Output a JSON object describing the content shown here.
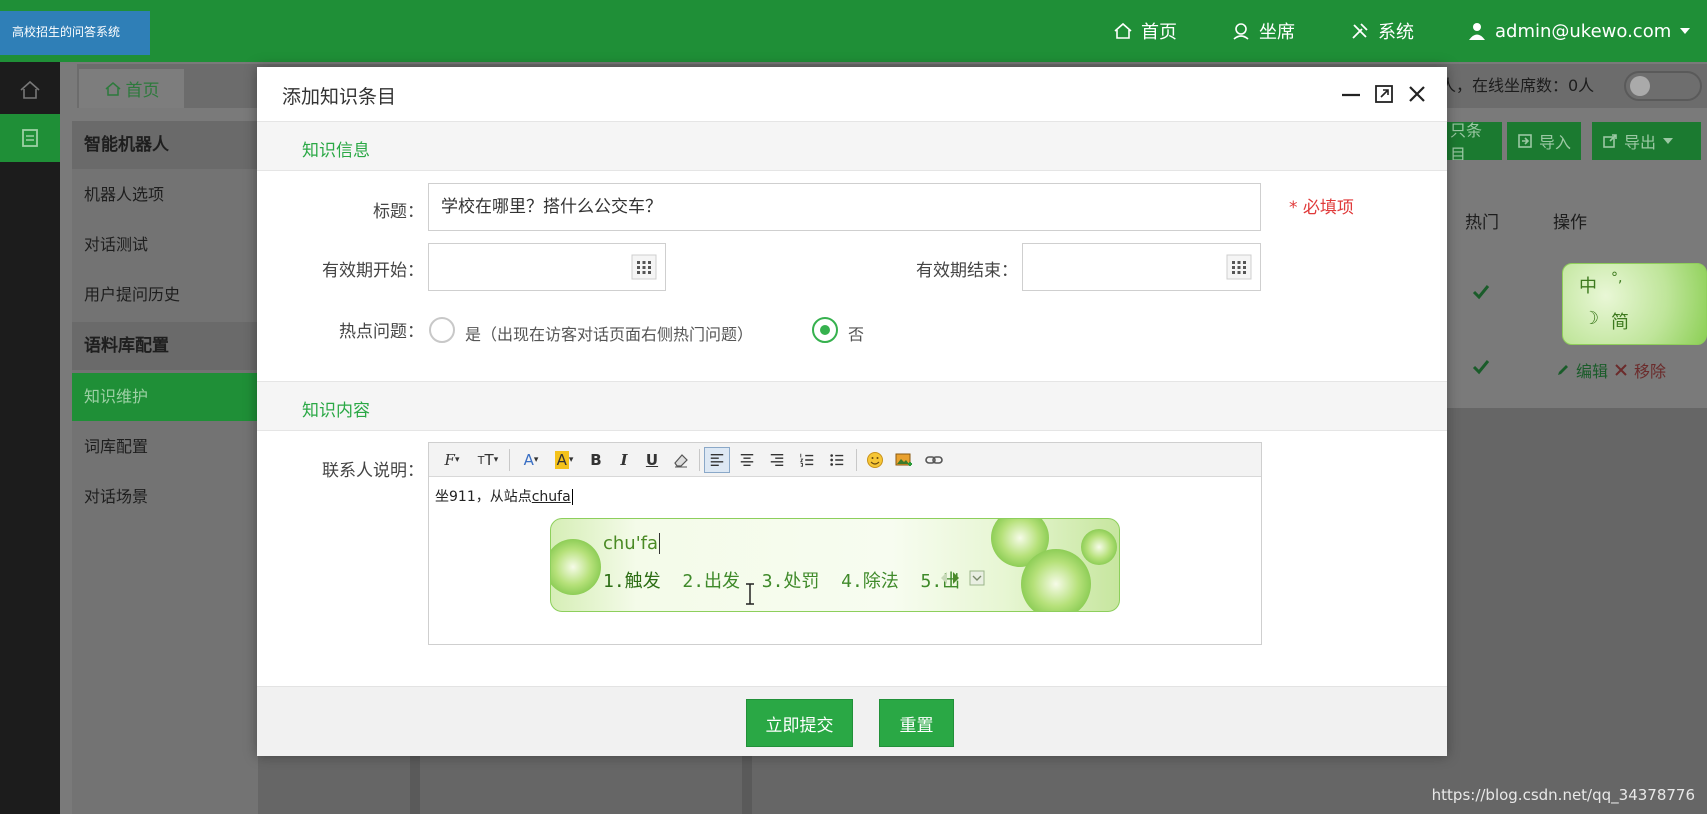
{
  "app": {
    "brand": "高校招生的问答系统",
    "watermark": "https://blog.csdn.net/qq_34378776"
  },
  "topnav": {
    "home": "首页",
    "seat": "坐席",
    "system": "系统",
    "user": "admin@ukewo.com"
  },
  "tabs": {
    "home": "首页"
  },
  "status_text": "人，在线坐席数：0人",
  "sidebar": {
    "items": [
      {
        "label": "智能机器人",
        "type": "group"
      },
      {
        "label": "机器人选项"
      },
      {
        "label": "对话测试"
      },
      {
        "label": "用户提问历史"
      },
      {
        "label": "语料库配置",
        "type": "group"
      },
      {
        "label": "知识维护",
        "active": true
      },
      {
        "label": "词库配置"
      },
      {
        "label": "对话场景"
      }
    ]
  },
  "toolbar": {
    "add_partial": "只条目",
    "import": "导入",
    "export": "导出"
  },
  "table": {
    "headers": [
      "热门",
      "操作"
    ],
    "row_edit": "编辑",
    "row_remove": "移除"
  },
  "ime_skin": {
    "mode": "中",
    "punct": "°,",
    "moon": "☽",
    "simp": "简"
  },
  "modal": {
    "title": "添加知识条目",
    "section_info": "知识信息",
    "title_label": "标题：",
    "title_value": "学校在哪里？搭什么公交车？",
    "required_note": "* 必填项",
    "start_label": "有效期开始：",
    "end_label": "有效期结束：",
    "hot_label": "热点问题：",
    "hot_yes": "是（出现在访客对话页面右侧热门问题）",
    "hot_no": "否",
    "hot_selected": "否",
    "section_content": "知识内容",
    "contact_label": "联系人说明：",
    "editor_text_prefix": "坐911，从站点",
    "editor_text_composing": "chufa",
    "submit_label": "立即提交",
    "reset_label": "重置"
  },
  "ime": {
    "composition": "chu'fa",
    "candidates": [
      "1.触发",
      "2.出发",
      "3.处罚",
      "4.除法",
      "5.出"
    ]
  },
  "colors": {
    "brand_green": "#1f8f37",
    "accent_green": "#2aa845",
    "required_red": "#e03a3a"
  }
}
